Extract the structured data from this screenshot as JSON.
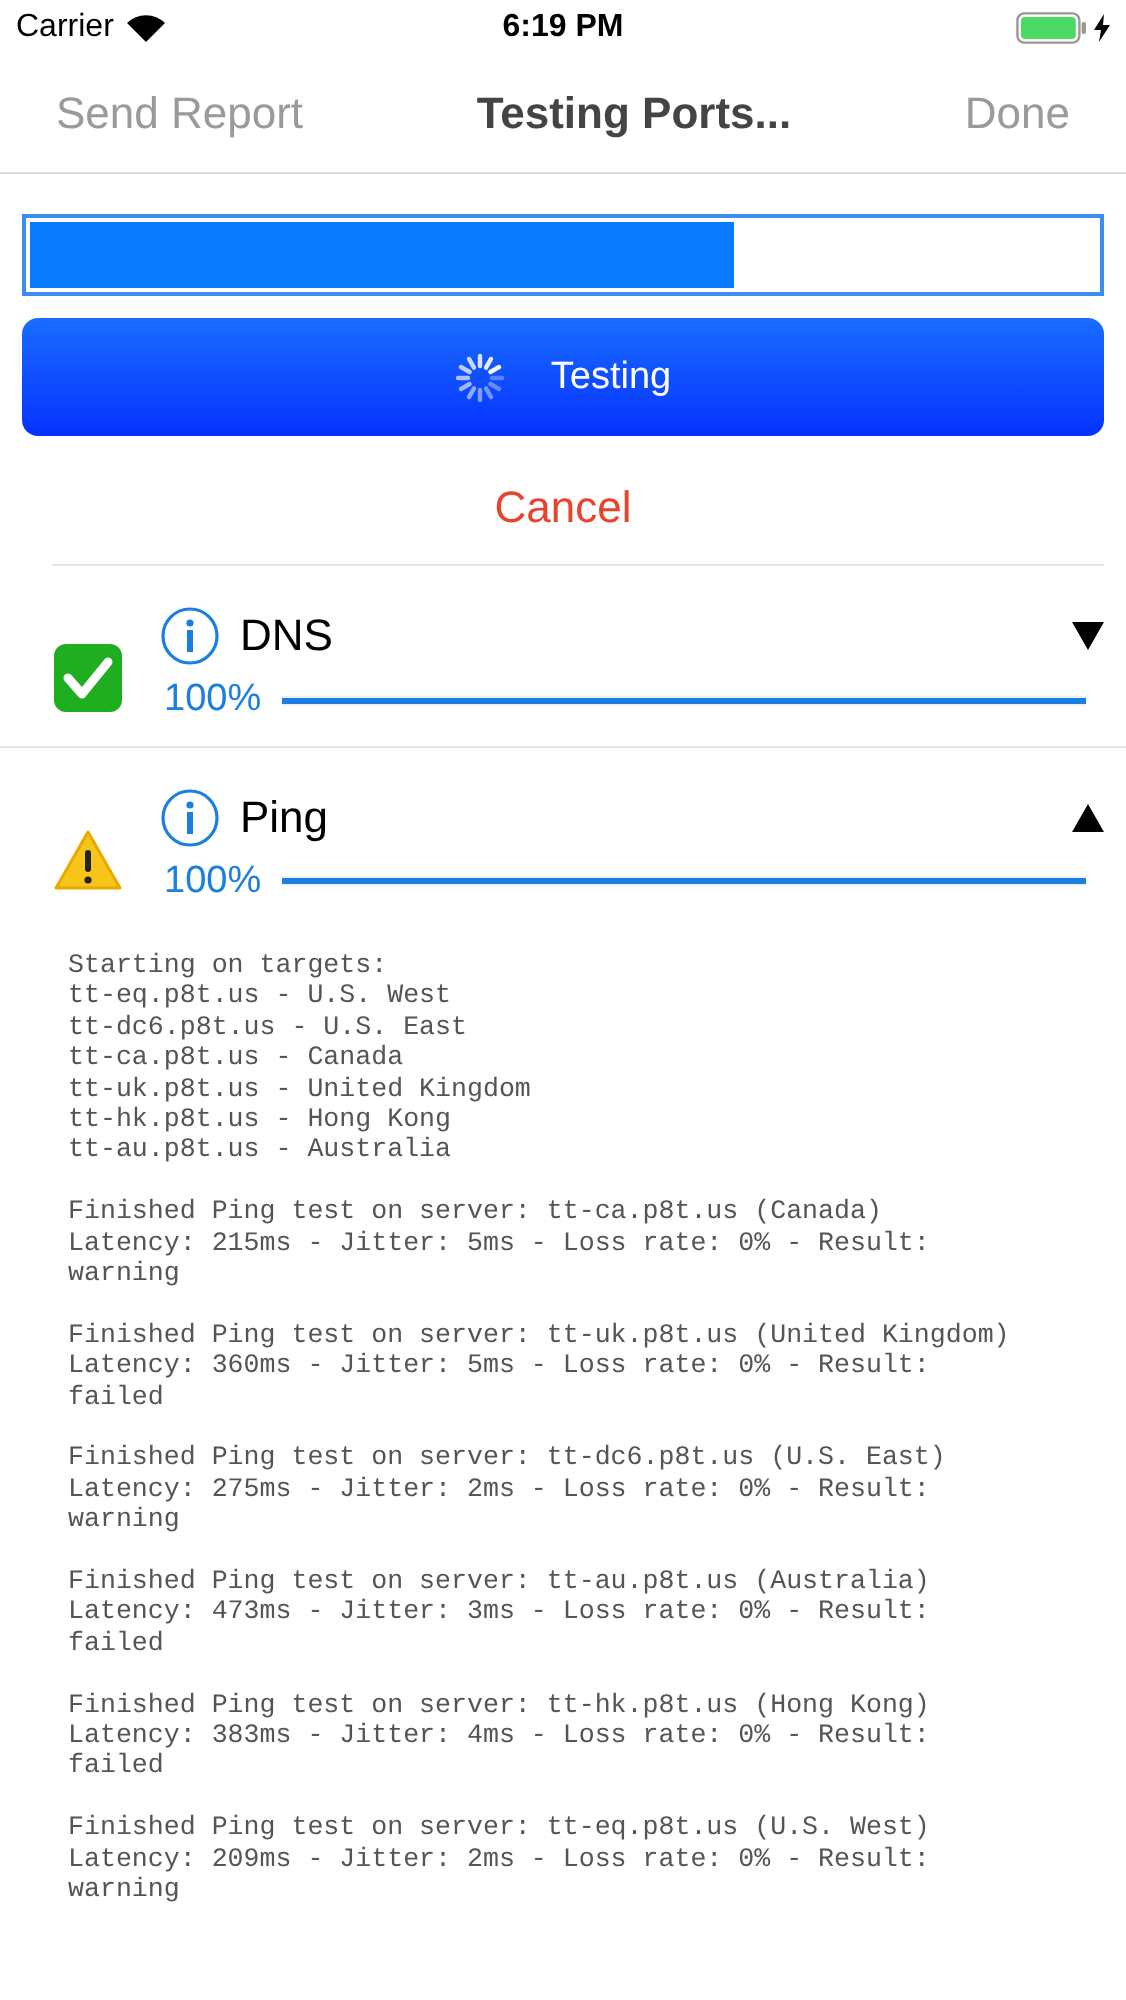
{
  "status_bar": {
    "carrier": "Carrier",
    "time": "6:19 PM"
  },
  "nav": {
    "left": "Send Report",
    "title": "Testing Ports...",
    "right": "Done",
    "left_disabled": true,
    "right_disabled": true
  },
  "overall_progress": {
    "level": 0.66
  },
  "action_button": {
    "label": "Testing",
    "busy": true
  },
  "cancel": "Cancel",
  "tests": [
    {
      "name": "DNS",
      "kind": "passed",
      "expanded": false,
      "percent": "100%",
      "level": 1.0
    },
    {
      "name": "Ping",
      "kind": "warning",
      "expanded": true,
      "percent": "100%",
      "level": 1.0
    }
  ],
  "log": [
    [
      "Starting on targets:",
      "tt-eq.p8t.us - U.S. West",
      "tt-dc6.p8t.us - U.S. East",
      "tt-ca.p8t.us - Canada",
      "tt-uk.p8t.us - United Kingdom",
      "tt-hk.p8t.us - Hong Kong",
      "tt-au.p8t.us - Australia"
    ],
    [
      "Finished Ping test on server: tt-ca.p8t.us (Canada)",
      "Latency: 215ms - Jitter: 5ms - Loss rate: 0% - Result:",
      "warning"
    ],
    [
      "Finished Ping test on server: tt-uk.p8t.us (United Kingdom)",
      "Latency: 360ms - Jitter: 5ms - Loss rate: 0% - Result:",
      "failed"
    ],
    [
      "Finished Ping test on server: tt-dc6.p8t.us (U.S. East)",
      "Latency: 275ms - Jitter: 2ms - Loss rate: 0% - Result:",
      "warning"
    ],
    [
      "Finished Ping test on server: tt-au.p8t.us (Australia)",
      "Latency: 473ms - Jitter: 3ms - Loss rate: 0% - Result:",
      "failed"
    ],
    [
      "Finished Ping test on server: tt-hk.p8t.us (Hong Kong)",
      "Latency: 383ms - Jitter: 4ms - Loss rate: 0% - Result:",
      "failed"
    ],
    [
      "Finished Ping test on server: tt-eq.p8t.us (U.S. West)",
      "Latency: 209ms - Jitter: 2ms - Loss rate: 0% - Result:",
      "warning"
    ]
  ]
}
